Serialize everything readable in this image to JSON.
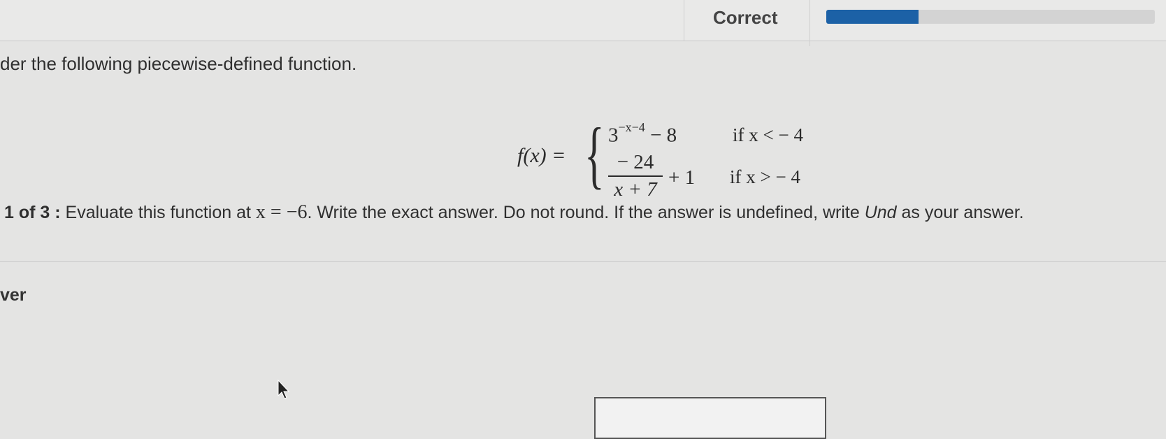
{
  "header": {
    "status": "Correct",
    "progress_fraction": 0.28
  },
  "intro": "der the following piecewise-defined function.",
  "function": {
    "lhs": "f(x) =",
    "case1_base": "3",
    "case1_exponent": "−x−4",
    "case1_tail": " − 8",
    "case1_condition": "if x < − 4",
    "case2_numerator": "− 24",
    "case2_denominator": "x + 7",
    "case2_tail": "+ 1",
    "case2_condition": "if x > − 4"
  },
  "question": {
    "number": "1 of 3 :",
    "text_before": " Evaluate this function at ",
    "math": "x = −6",
    "text_after": ". Write the exact answer. Do not round. If the answer is undefined, write ",
    "und": "Und",
    "text_end": " as your answer."
  },
  "answer": {
    "label": "ver",
    "value": ""
  }
}
